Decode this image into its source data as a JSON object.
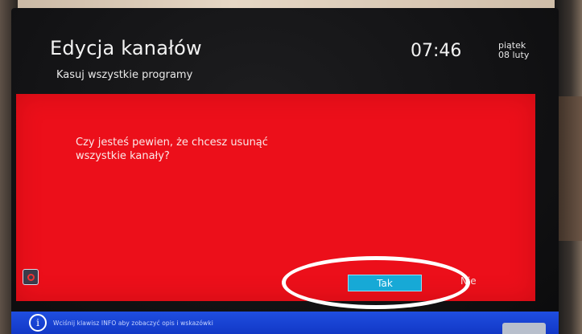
{
  "header": {
    "title": "Edycja kanałów",
    "subtitle": "Kasuj wszystkie programy",
    "time": "07:46",
    "day": "piątek",
    "date": "08 luty"
  },
  "dialog": {
    "message": "Czy jesteś pewien, że chcesz usunąć wszystkie kanały?",
    "confirm_label": "Tak",
    "cancel_label": "Nie",
    "selected_option": "Tak"
  },
  "info_bar": {
    "text": "Wciśnij klawisz INFO aby zobaczyć opis i wskazówki"
  },
  "colors": {
    "dialog_background": "#ec0f1a",
    "selected_button": "#17a9d6",
    "info_bar": "#1f4ee0",
    "screen_background": "#121214"
  }
}
